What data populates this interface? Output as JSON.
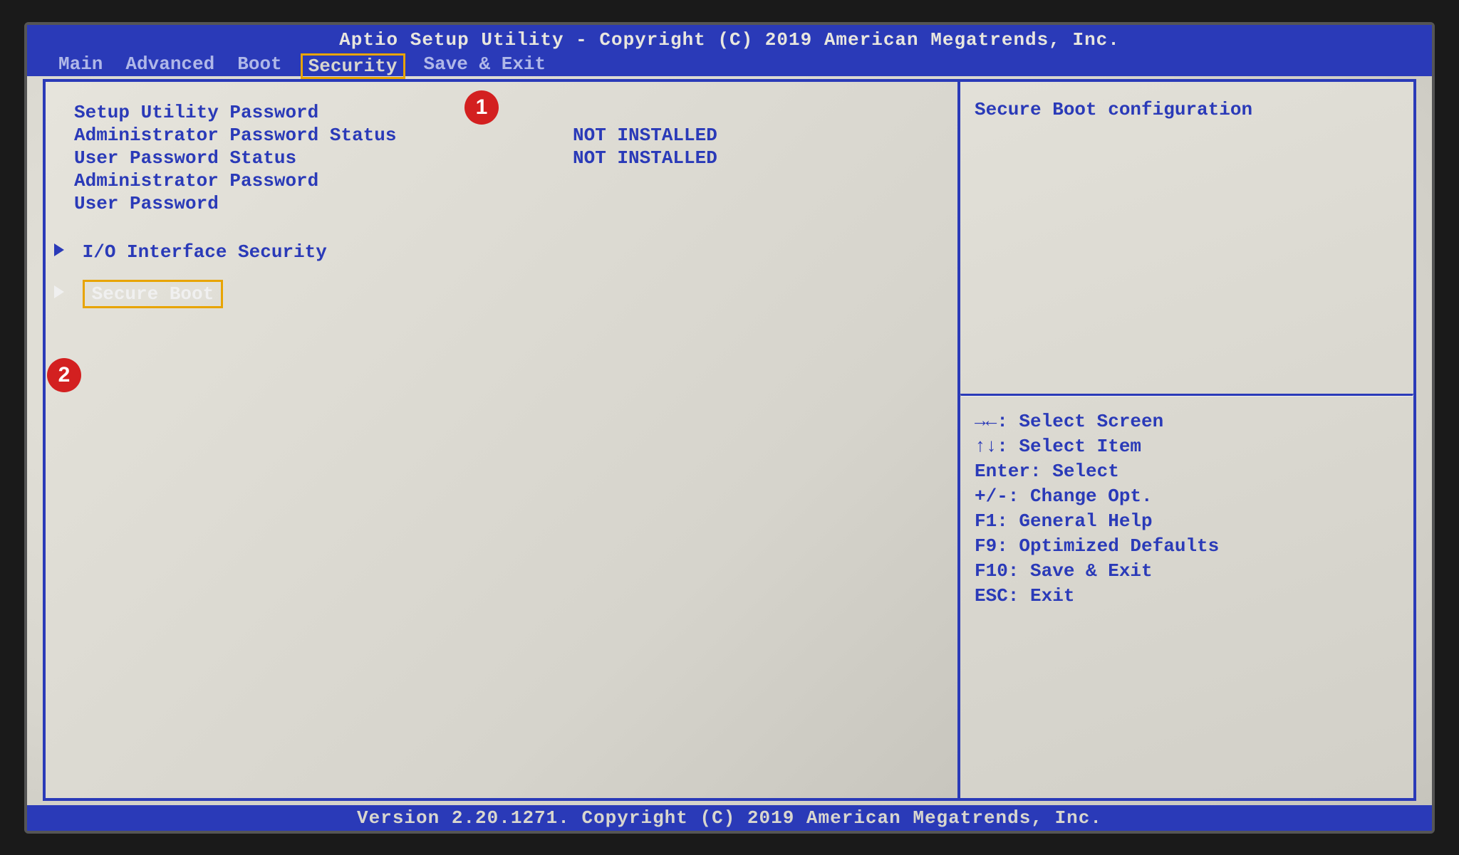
{
  "header": {
    "title": "Aptio Setup Utility - Copyright (C) 2019 American Megatrends, Inc.",
    "tabs": [
      "Main",
      "Advanced",
      "Boot",
      "Security",
      "Save & Exit"
    ],
    "active_tab_index": 3
  },
  "main": {
    "section_label": "Setup Utility Password",
    "rows": [
      {
        "label": "Administrator Password Status",
        "value": "NOT INSTALLED"
      },
      {
        "label": "User Password Status",
        "value": "NOT INSTALLED"
      }
    ],
    "selectable": [
      "Administrator Password",
      "User Password"
    ],
    "submenus": [
      {
        "label": "I/O Interface Security",
        "selected": false
      },
      {
        "label": "Secure Boot",
        "selected": true
      }
    ]
  },
  "side": {
    "help_text": "Secure Boot configuration",
    "hints": [
      "→←: Select Screen",
      "↑↓: Select Item",
      "Enter: Select",
      "+/-: Change Opt.",
      "F1: General Help",
      "F9: Optimized Defaults",
      "F10: Save & Exit",
      "ESC: Exit"
    ]
  },
  "footer": {
    "text": "Version 2.20.1271. Copyright (C) 2019 American Megatrends, Inc."
  },
  "annotations": {
    "a1": "1",
    "a2": "2"
  }
}
